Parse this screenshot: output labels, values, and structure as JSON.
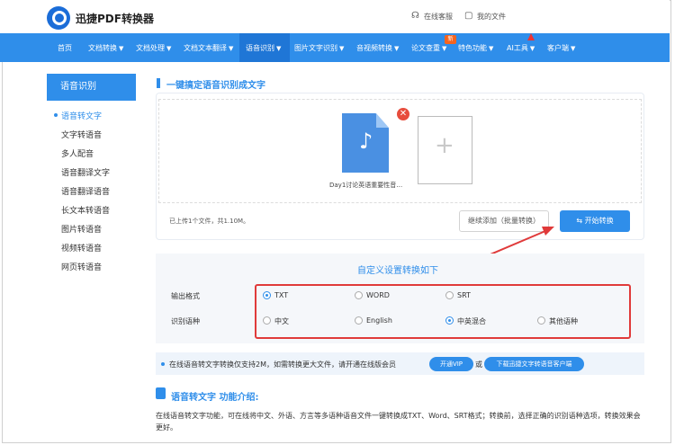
{
  "header": {
    "brand": "迅捷PDF转换器",
    "links": [
      {
        "label": "在线客服",
        "icon": "headset-icon"
      },
      {
        "label": "我的文件",
        "icon": "file-icon"
      }
    ]
  },
  "nav": {
    "items": [
      {
        "label": "首页"
      },
      {
        "label": "文档转换",
        "arrow": "▼"
      },
      {
        "label": "文档处理",
        "arrow": "▼"
      },
      {
        "label": "文档文本翻译",
        "arrow": "▼"
      },
      {
        "label": "语音识别",
        "arrow": "▼"
      },
      {
        "label": "图片文字识别",
        "arrow": "▼"
      },
      {
        "label": "音视频转换",
        "arrow": "▼"
      },
      {
        "label": "论文查重",
        "arrow": "▼"
      },
      {
        "label": "特色功能",
        "arrow": "▼"
      },
      {
        "label": "AI工具",
        "arrow": "▼"
      },
      {
        "label": "客户端",
        "arrow": "▼"
      }
    ],
    "new_badge": "新"
  },
  "sidebar": {
    "title": "语音识别",
    "items": [
      {
        "label": "语音转文字"
      },
      {
        "label": "文字转语音"
      },
      {
        "label": "多人配音"
      },
      {
        "label": "语音翻译文字"
      },
      {
        "label": "语音翻译语音"
      },
      {
        "label": "长文本转语音"
      },
      {
        "label": "图片转语音"
      },
      {
        "label": "视频转语音"
      },
      {
        "label": "网页转语音"
      }
    ]
  },
  "main": {
    "section_title": "一键搞定语音识别成文字",
    "file": {
      "name": "Day1讨论英语重要性音频...",
      "icon": "audio-file-icon"
    },
    "upload_info": "已上传1个文件，共1.10M。",
    "continue_button": "继续添加（批量转换）",
    "start_button": "开始转换",
    "settings_title": "自定义设置转换如下",
    "output_format": {
      "label": "输出格式",
      "options": [
        "TXT",
        "WORD",
        "SRT"
      ],
      "selected": "TXT"
    },
    "language": {
      "label": "识别语种",
      "options": [
        "中文",
        "English",
        "中英混合",
        "其他语种"
      ],
      "selected": "中英混合"
    },
    "promo": {
      "text": "在线语音转文字转换仅支持2M，如需转换更大文件，请开通在线版会员",
      "vip_button": "开通VIP",
      "or": "或",
      "download_button": "下载迅捷文字转语音客户端"
    },
    "intro_title": "语音转文字 功能介绍:",
    "intro_text": "在线语音转文字功能，可在线将中文、外语、方言等多语种语音文件一键转换成TXT、Word、SRT格式；转换前，选择正确的识别语种选项，转换效果会更好。"
  },
  "colors": {
    "accent": "#2f8eea",
    "highlight_box": "#e03a3a",
    "close": "#e74c3c"
  }
}
